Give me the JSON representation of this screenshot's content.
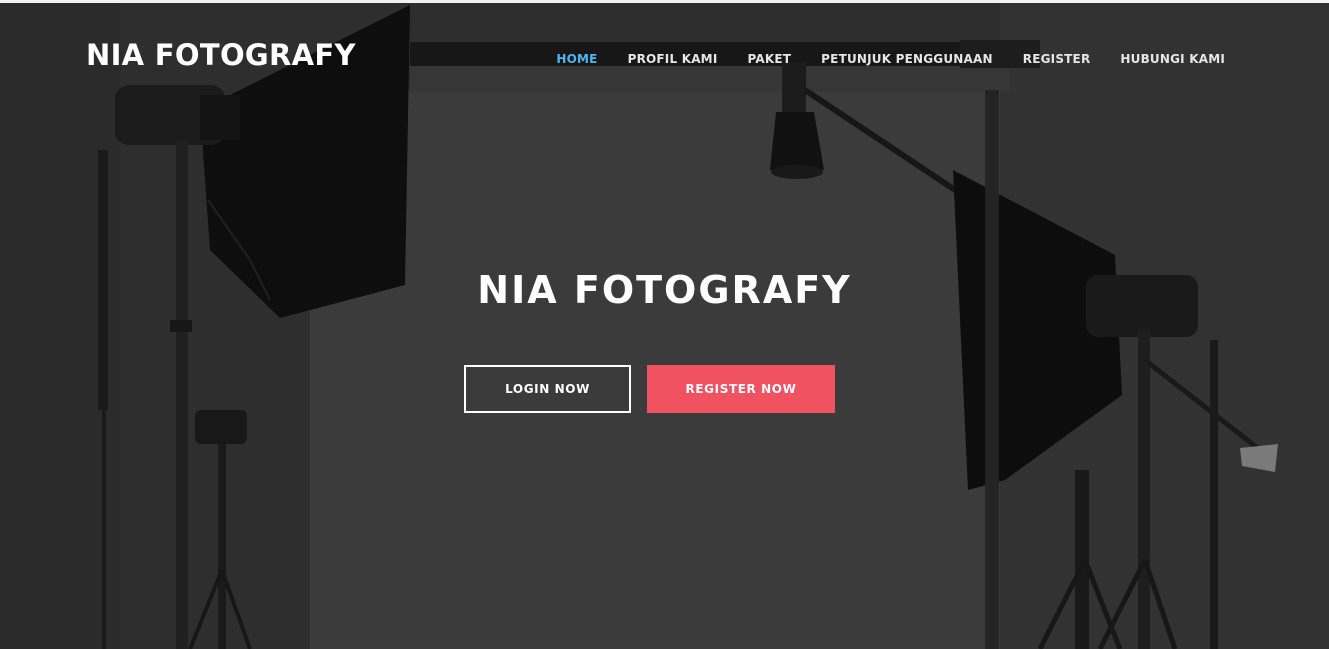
{
  "brand": "NIA FOTOGRAFY",
  "nav": [
    {
      "label": "HOME",
      "active": true
    },
    {
      "label": "PROFIL KAMI",
      "active": false
    },
    {
      "label": "PAKET",
      "active": false
    },
    {
      "label": "PETUNJUK PENGGUNAAN",
      "active": false
    },
    {
      "label": "REGISTER",
      "active": false
    },
    {
      "label": "HUBUNGI KAMI",
      "active": false
    }
  ],
  "hero": {
    "title": "NIA FOTOGRAFY",
    "login_label": "LOGIN NOW",
    "register_label": "REGISTER NOW"
  },
  "colors": {
    "active_nav": "#4fb5f0",
    "primary_button": "#f05262",
    "overlay": "#3b3a3b"
  }
}
